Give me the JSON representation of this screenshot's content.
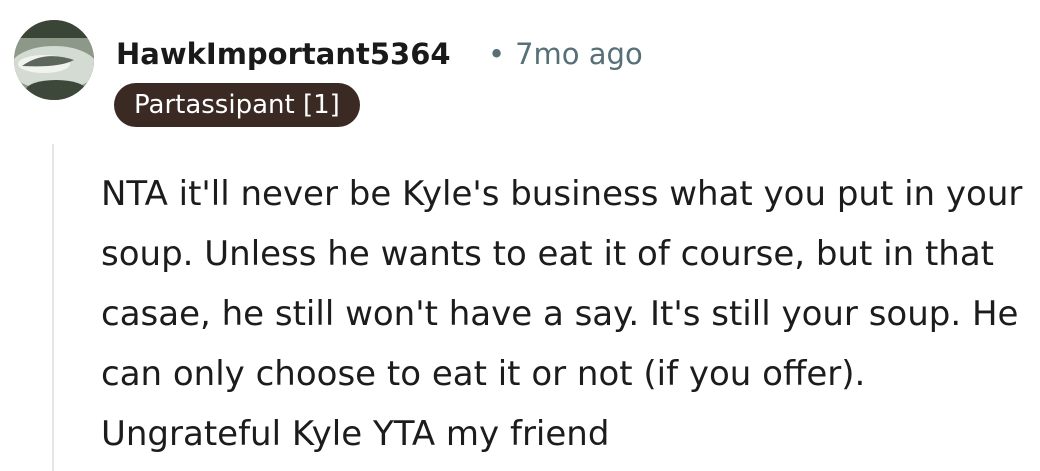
{
  "comment": {
    "author": "HawkImportant5364",
    "separator": "•",
    "timestamp": "7mo ago",
    "flair": "Partassipant [1]",
    "body": "NTA it'll never be Kyle's business what you put in your soup. Unless he wants to eat it of course, but in that casae, he still won't have a say. It's still your soup. He can only choose to eat it or not (if you offer). Ungrateful Kyle YTA my friend"
  },
  "colors": {
    "author": "#1a1a1b",
    "timestamp": "#576f76",
    "flair_background": "#3b2a24",
    "flair_text": "#ffffff",
    "body_text": "#1c1c1c",
    "thread_line": "#e3e5e6"
  },
  "icons": {
    "avatar": "user-avatar-photo"
  }
}
